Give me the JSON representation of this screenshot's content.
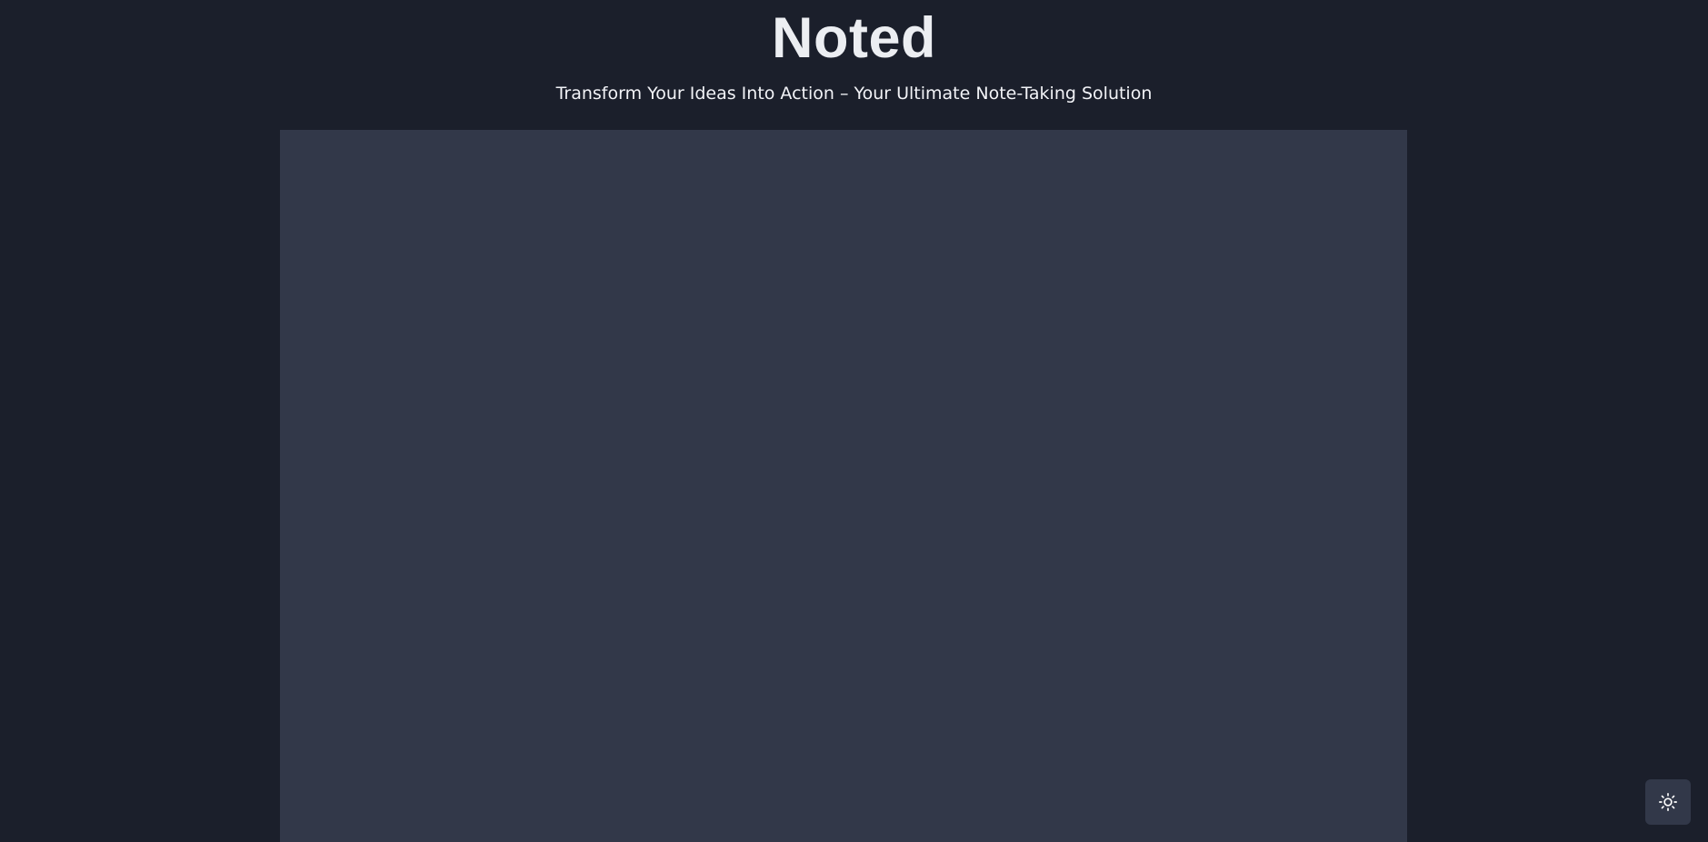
{
  "header": {
    "title": "Noted",
    "tagline": "Transform Your Ideas Into Action – Your Ultimate Note-Taking Solution"
  },
  "notes_panel": {
    "content": ""
  },
  "theme_toggle": {
    "icon": "sun-icon"
  },
  "colors": {
    "background": "#1b1f2b",
    "panel": "#323849",
    "text": "#eef0f4"
  }
}
